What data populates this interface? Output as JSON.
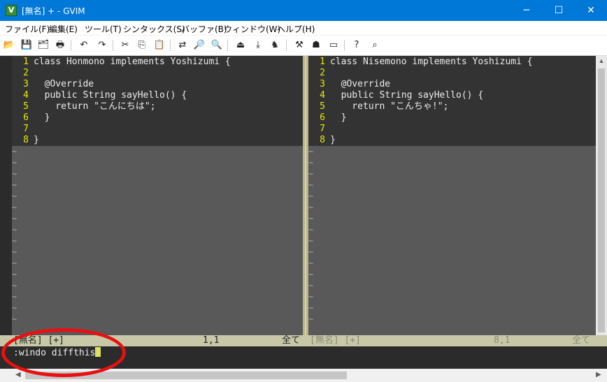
{
  "window": {
    "title": "[無名] + - GVIM",
    "app_icon": "V",
    "minimize": "─",
    "maximize": "☐",
    "close": "✕"
  },
  "menu": [
    "ファイル(F)",
    "編集(E)",
    "ツール(T)",
    "シンタックス(S)",
    "バッファ(B)",
    "ウィンドウ(W)",
    "ヘルプ(H)"
  ],
  "toolbar": [
    {
      "name": "open-icon",
      "glyph": "📂"
    },
    {
      "name": "save-icon",
      "glyph": "💾"
    },
    {
      "name": "save-all-icon",
      "glyph": "🗂"
    },
    {
      "name": "print-icon",
      "glyph": "🖶"
    },
    {
      "name": "undo-icon",
      "glyph": "↶"
    },
    {
      "name": "redo-icon",
      "glyph": "↷"
    },
    {
      "name": "cut-icon",
      "glyph": "✂"
    },
    {
      "name": "copy-icon",
      "glyph": "⎘"
    },
    {
      "name": "paste-icon",
      "glyph": "📋"
    },
    {
      "name": "replace-icon",
      "glyph": "⇄"
    },
    {
      "name": "find-next-icon",
      "glyph": "🔎"
    },
    {
      "name": "find-prev-icon",
      "glyph": "🔍"
    },
    {
      "name": "load-session-icon",
      "glyph": "⏏"
    },
    {
      "name": "save-session-icon",
      "glyph": "⤓"
    },
    {
      "name": "run-script-icon",
      "glyph": "♞"
    },
    {
      "name": "make-icon",
      "glyph": "⚒"
    },
    {
      "name": "shell-icon",
      "glyph": "☗"
    },
    {
      "name": "ctags-icon",
      "glyph": "▭"
    },
    {
      "name": "help-icon",
      "glyph": "?"
    },
    {
      "name": "find-help-icon",
      "glyph": "⌕"
    }
  ],
  "left_pane": {
    "lines": [
      {
        "num": "1",
        "text": "class Honmono implements Yoshizumi {"
      },
      {
        "num": "2",
        "text": ""
      },
      {
        "num": "3",
        "text": "  @Override"
      },
      {
        "num": "4",
        "text": "  public String sayHello() {"
      },
      {
        "num": "5",
        "text": "    return \"こんにちは\";"
      },
      {
        "num": "6",
        "text": "  }"
      },
      {
        "num": "7",
        "text": ""
      },
      {
        "num": "8",
        "text": "}"
      }
    ]
  },
  "right_pane": {
    "lines": [
      {
        "num": "1",
        "text": "class Nisemono implements Yoshizumi {"
      },
      {
        "num": "2",
        "text": ""
      },
      {
        "num": "3",
        "text": "  @Override"
      },
      {
        "num": "4",
        "text": "  public String sayHello() {"
      },
      {
        "num": "5",
        "text": "    return \"こんちゃ!\";"
      },
      {
        "num": "6",
        "text": "  }"
      },
      {
        "num": "7",
        "text": ""
      },
      {
        "num": "8",
        "text": "}"
      }
    ]
  },
  "tilde_char": "~",
  "status_left": {
    "name": "[無名] [+]",
    "pos": "1,1",
    "all": "全て"
  },
  "status_right": {
    "name": "[無名] [+]",
    "pos": "8,1",
    "all": "全て"
  },
  "command_line": ":windo diffthis",
  "hscroll": {
    "left": "◀",
    "right": "▶"
  },
  "vscroll": {
    "up": "▲"
  },
  "colors": {
    "titlebar": "#0078d7",
    "line_number": "#e8e800",
    "code_text": "#ececec",
    "tilde": "#a4a4c8",
    "statusline": "#c8c8a8",
    "annotation_ring": "#e81010"
  }
}
